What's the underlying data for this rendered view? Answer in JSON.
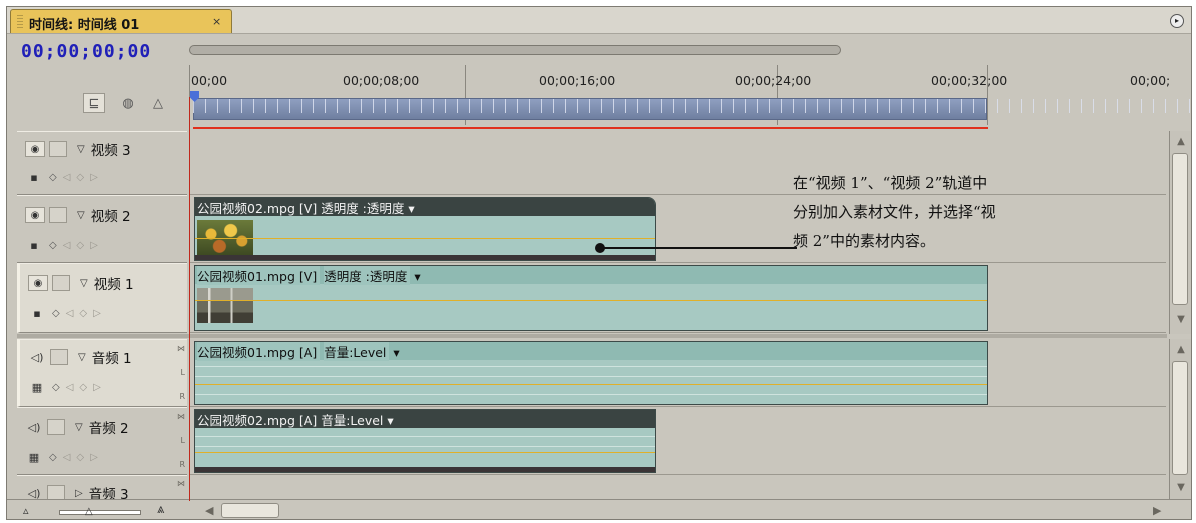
{
  "tab": {
    "title": "时间线: 时间线 01",
    "close": "×",
    "menu_glyph": "▸"
  },
  "timecode": "00;00;00;00",
  "ruler": {
    "labels": [
      "00;00",
      "00;00;08;00",
      "00;00;16;00",
      "00;00;24;00",
      "00;00;32;00",
      "00;00;"
    ]
  },
  "tools": {
    "snap_glyph": "⊑",
    "marker_glyph": "◍",
    "mark_glyph": "△"
  },
  "tracks": {
    "v3": {
      "name": "视频 3",
      "eye": "◉",
      "collapse": "▽"
    },
    "v2": {
      "name": "视频 2",
      "eye": "◉",
      "collapse": "▽"
    },
    "v1": {
      "name": "视频 1",
      "eye": "◉",
      "collapse": "▽"
    },
    "a1": {
      "name": "音频 1",
      "speaker": "◁)",
      "collapse": "▽"
    },
    "a2": {
      "name": "音频 2",
      "speaker": "◁)",
      "collapse": "▽"
    },
    "a3": {
      "name": "音频 3",
      "speaker": "◁)",
      "collapse": "▷"
    }
  },
  "track_controls": {
    "display": "▪",
    "keyframe": "◇",
    "prev": "◁",
    "add": "◇",
    "next": "▷",
    "wave": "▦",
    "sync_top": "⋈",
    "sync_l": "L",
    "sync_r": "R"
  },
  "clips": {
    "v2": {
      "title": "公园视频02.mpg [V]",
      "effect": "透明度 :透明度",
      "arrow": "▾"
    },
    "v1": {
      "title": "公园视频01.mpg [V]",
      "effect": "透明度 :透明度",
      "arrow": "▾"
    },
    "a1": {
      "title": "公园视频01.mpg [A]",
      "effect": "音量:Level",
      "arrow": "▾"
    },
    "a2": {
      "title": "公园视频02.mpg [A]",
      "effect": "音量:Level",
      "arrow": "▾"
    }
  },
  "annotation": {
    "line1": "在“视频 1”、“视频 2”轨道中",
    "line2": "分别加入素材文件，并选择“视",
    "line3": "频 2”中的素材内容。"
  },
  "bottom": {
    "zoom_out": "▵",
    "zoom_thumb": "△",
    "zoom_in": "⩓",
    "scroll_left": "◀",
    "scroll_right": "▶"
  },
  "scroll": {
    "up": "▲",
    "down": "▼"
  },
  "colors": {
    "timecode": "#2020b8",
    "tab": "#e9c45a",
    "clip_video": "#a7c9c2",
    "clip_header_dark": "#3a4442",
    "playhead": "#c0281c",
    "keyframe_line": "#e0b02a"
  }
}
